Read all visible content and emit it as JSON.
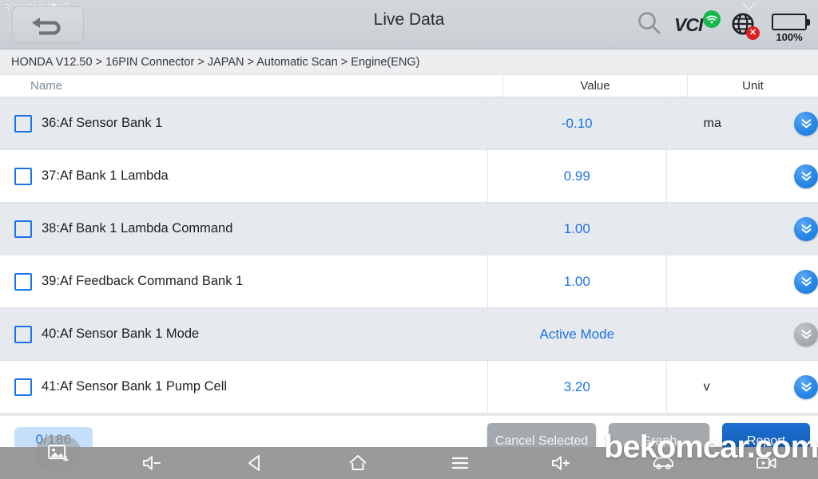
{
  "statusbar": {
    "time": "3:30 PM",
    "icons": [
      "screenshot-icon",
      "upload-icon"
    ],
    "battery_percent_top": "100%"
  },
  "header": {
    "title": "Live Data",
    "back_label": "Back",
    "search_icon": "search-icon",
    "vci_label": "VCI",
    "vci_status": "connected",
    "globe_status": "disconnected",
    "globe_badge": "✕",
    "battery_percent": "100%"
  },
  "breadcrumb": {
    "text": "HONDA V12.50 > 16PIN Connector  > JAPAN  > Automatic Scan  > Engine(ENG)"
  },
  "table": {
    "columns": {
      "name": "Name",
      "value": "Value",
      "unit": "Unit"
    },
    "rows": [
      {
        "id": "36",
        "name": "36:Af Sensor Bank 1",
        "value": "-0.10",
        "unit": "ma",
        "chevron_enabled": true,
        "checked": false
      },
      {
        "id": "37",
        "name": "37:Af Bank 1 Lambda",
        "value": "0.99",
        "unit": "",
        "chevron_enabled": true,
        "checked": false
      },
      {
        "id": "38",
        "name": "38:Af Bank 1 Lambda Command",
        "value": "1.00",
        "unit": "",
        "chevron_enabled": true,
        "checked": false
      },
      {
        "id": "39",
        "name": "39:Af Feedback Command Bank 1",
        "value": "1.00",
        "unit": "",
        "chevron_enabled": true,
        "checked": false
      },
      {
        "id": "40",
        "name": "40:Af Sensor Bank 1 Mode",
        "value": "Active Mode",
        "unit": "",
        "chevron_enabled": false,
        "checked": false
      },
      {
        "id": "41",
        "name": "41:Af Sensor Bank 1 Pump Cell",
        "value": "3.20",
        "unit": "v",
        "chevron_enabled": true,
        "checked": false
      }
    ]
  },
  "actionbar": {
    "selected_count": "0",
    "total_count": "/186",
    "cancel_selected_label": "Cancel Selected",
    "middle_label": "Graph",
    "record_label": "Report"
  },
  "navbar": {
    "items": [
      "screenshot-icon",
      "volume-down-icon",
      "back-icon",
      "home-icon",
      "recent-apps-icon",
      "volume-up-icon",
      "car-icon",
      "screen-record-icon"
    ]
  },
  "watermark": {
    "text": "bekomcar.com"
  },
  "colors": {
    "accent_blue": "#1a73e8",
    "row_alt": "#e6eaef",
    "header_gray": "#cfd4d9",
    "nav_gray": "#9a9a9a",
    "ok_green": "#16b84e",
    "error_red": "#e02020"
  }
}
